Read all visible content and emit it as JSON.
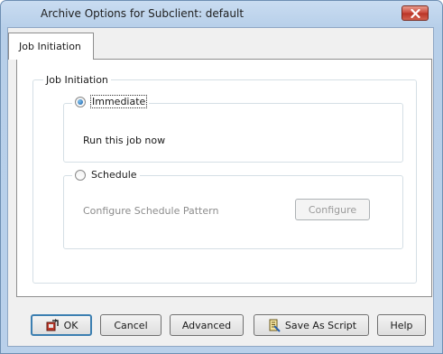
{
  "window": {
    "title": "Archive Options for Subclient: default"
  },
  "tabs": [
    {
      "label": "Job Initiation"
    }
  ],
  "job_initiation": {
    "group_label": "Job Initiation",
    "immediate": {
      "label": "Immediate",
      "selected": true,
      "description": "Run this job now"
    },
    "schedule": {
      "label": "Schedule",
      "selected": false,
      "description": "Configure Schedule Pattern",
      "configure_label": "Configure"
    }
  },
  "footer": {
    "ok_label": "OK",
    "cancel_label": "Cancel",
    "advanced_label": "Advanced",
    "save_script_label": "Save As Script",
    "help_label": "Help"
  },
  "colors": {
    "close_button": "#c9473a",
    "default_button_border": "#3c7fb1",
    "disabled_text": "#8c8c8c"
  },
  "icons": {
    "close": "close-icon",
    "ok": "ok-icon",
    "save_script": "script-icon"
  }
}
